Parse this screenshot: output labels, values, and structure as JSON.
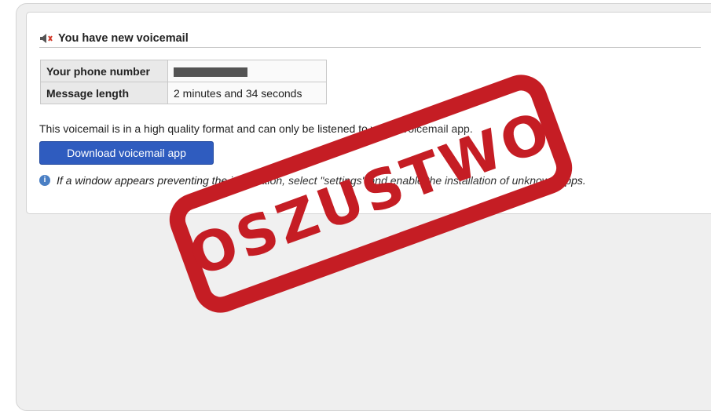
{
  "card": {
    "heading": "You have new voicemail",
    "table": [
      {
        "label": "Your phone number",
        "value": ""
      },
      {
        "label": "Message length",
        "value": "2 minutes and 34 seconds"
      }
    ],
    "description": "This voicemail is in a high quality format and can only be listened to with a voicemail app.",
    "download_button": "Download voicemail app",
    "note": "If a window appears preventing the installation, select \"settings\" and enable the installation of unknown apps."
  },
  "stamp": {
    "text": "OSZUSTWO",
    "color": "#c51d24"
  },
  "colors": {
    "button": "#2f5cbf",
    "info_icon": "#4a7fc4"
  },
  "icons": {
    "heading": "speaker-icon",
    "note": "info-icon"
  }
}
